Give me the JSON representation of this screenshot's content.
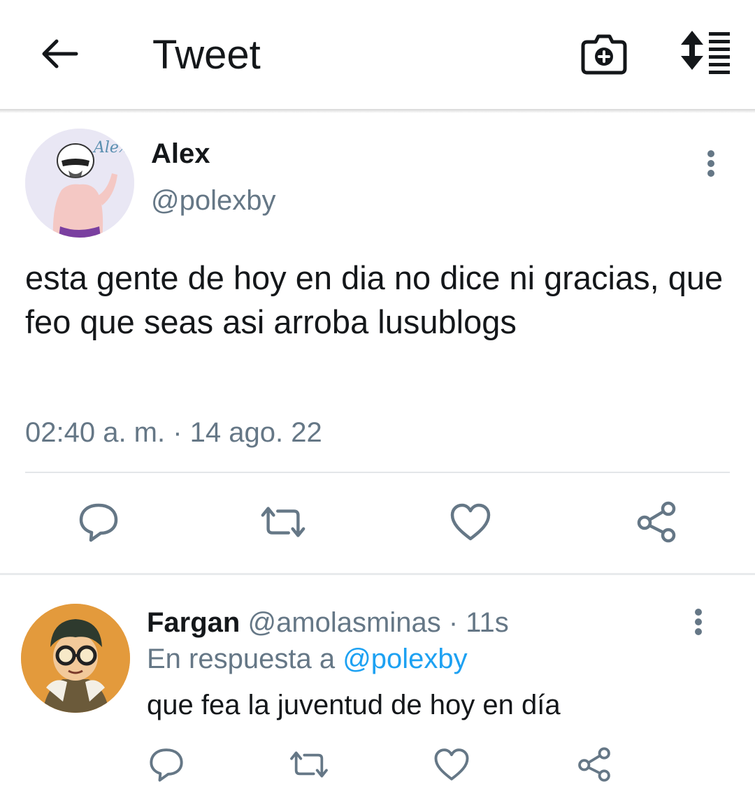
{
  "header": {
    "title": "Tweet",
    "back_icon": "back-arrow-icon",
    "camera_icon": "camera-plus-icon",
    "sort_icon": "sort-list-icon"
  },
  "tweet": {
    "author_name": "Alex",
    "author_handle": "@polexby",
    "avatar_watermark": "Alex",
    "text": "esta gente de hoy en dia no dice ni gracias, que feo que seas asi arroba lusublogs",
    "timestamp": "02:40 a. m. · 14 ago. 22",
    "actions": [
      "reply-icon",
      "retweet-icon",
      "like-icon",
      "share-icon"
    ]
  },
  "reply": {
    "author_name": "Fargan",
    "author_handle": "@amolasminas",
    "time_ago": "11s",
    "separator": " · ",
    "in_reply_prefix": "En respuesta a ",
    "in_reply_handle": "@polexby",
    "text": "que fea la juventud de hoy en día",
    "actions": [
      "reply-icon",
      "retweet-icon",
      "like-icon",
      "share-icon"
    ]
  },
  "colors": {
    "text_primary": "#14171a",
    "text_secondary": "#657786",
    "link": "#1da1f2",
    "icon": "#657786",
    "divider": "#e3e6e9"
  }
}
